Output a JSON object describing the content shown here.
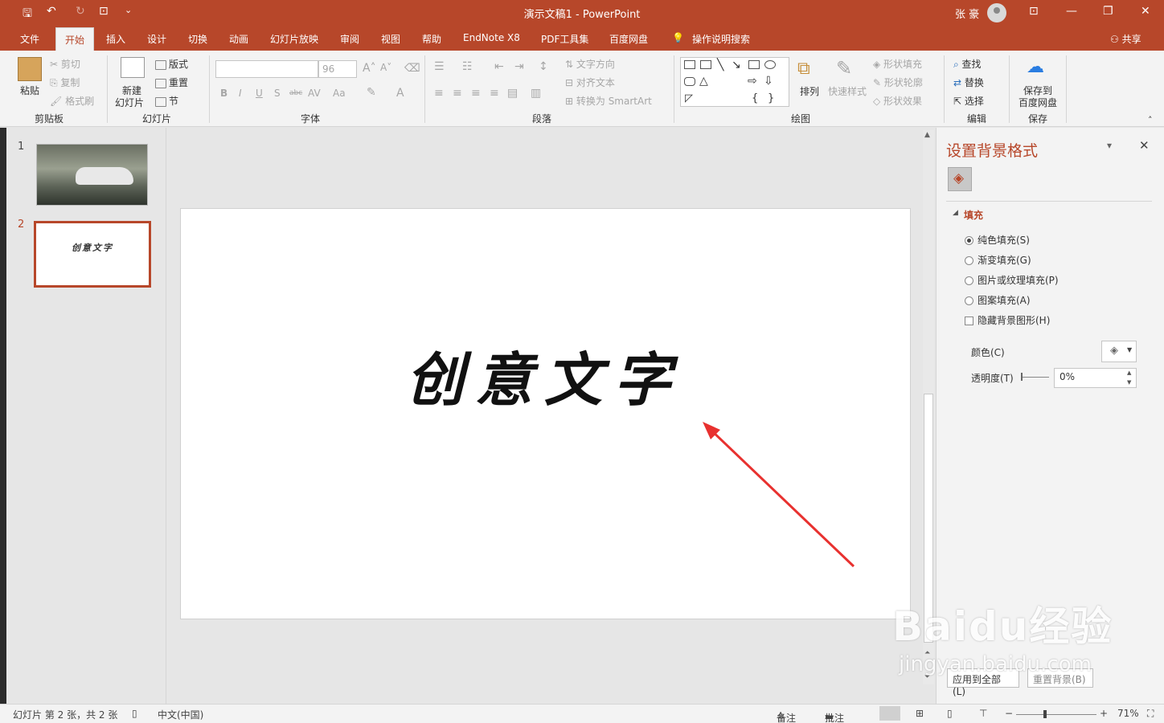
{
  "window": {
    "title": "演示文稿1  -  PowerPoint",
    "user": "张 豪",
    "share": "共享"
  },
  "qat": {
    "save": "🖫",
    "undo": "↶",
    "redo": "↻",
    "present": "⊡",
    "more": "⌄"
  },
  "winctrl": {
    "ribbon_opts": "⊡",
    "minimize": "—",
    "restore": "❐",
    "close": "✕"
  },
  "tabs": [
    "文件",
    "开始",
    "插入",
    "设计",
    "切换",
    "动画",
    "幻灯片放映",
    "审阅",
    "视图",
    "帮助",
    "EndNote X8",
    "PDF工具集",
    "百度网盘",
    "操作说明搜索"
  ],
  "ribbon": {
    "clipboard": {
      "group": "剪贴板",
      "paste": "粘贴",
      "cut": "剪切",
      "copy": "复制",
      "painter": "格式刷"
    },
    "slides": {
      "group": "幻灯片",
      "new": "新建",
      "new2": "幻灯片",
      "layout": "版式",
      "reset": "重置",
      "section": "节"
    },
    "font": {
      "group": "字体",
      "size": "96",
      "bold": "B",
      "italic": "I",
      "underline": "U",
      "shadow": "S",
      "strike": "abc",
      "spacing": "AV",
      "case": "Aa",
      "fontcolor": "A"
    },
    "paragraph": {
      "group": "段落",
      "textdir": "文字方向",
      "align": "对齐文本",
      "smartart": "转换为 SmartArt"
    },
    "drawing": {
      "group": "绘图",
      "arrange": "排列",
      "quick": "快速样式",
      "fill": "形状填充",
      "outline": "形状轮廓",
      "effect": "形状效果"
    },
    "editing": {
      "group": "编辑",
      "find": "查找",
      "replace": "替换",
      "select": "选择"
    },
    "save": {
      "group": "保存",
      "saveto": "保存到",
      "baidu": "百度网盘"
    }
  },
  "thumbs": [
    {
      "num": "1"
    },
    {
      "num": "2",
      "text": "创意文字"
    }
  ],
  "slide": {
    "text": "创意文字"
  },
  "pane": {
    "title": "设置背景格式",
    "section": "填充",
    "options": [
      {
        "label": "纯色填充(S)",
        "checked": true
      },
      {
        "label": "渐变填充(G)",
        "checked": false
      },
      {
        "label": "图片或纹理填充(P)",
        "checked": false
      },
      {
        "label": "图案填充(A)",
        "checked": false
      }
    ],
    "hide": "隐藏背景图形(H)",
    "color": "颜色(C)",
    "transparency": "透明度(T)",
    "trans_value": "0%",
    "apply_all": "应用到全部(L)",
    "reset": "重置背景(B)"
  },
  "status": {
    "slide": "幻灯片 第 2 张，共 2 张",
    "lang": "中文(中国)",
    "notes": "备注",
    "comments": "批注",
    "zoom": "71%",
    "plus": "+",
    "minus": "−"
  },
  "watermark": {
    "brand": "Baidu经验",
    "url": "jingyan.baidu.com"
  },
  "colors": {
    "accent": "#b7472a",
    "arrow": "#e8312f"
  }
}
